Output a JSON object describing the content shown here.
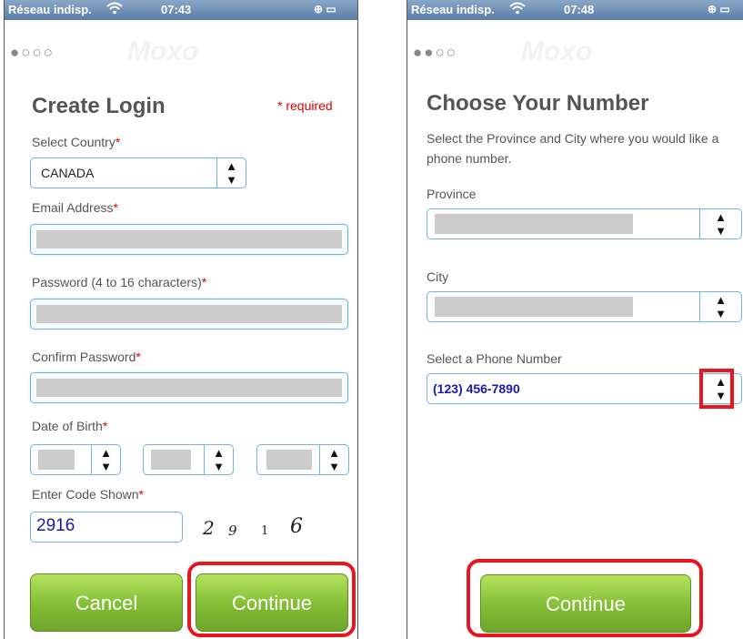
{
  "left": {
    "status": {
      "carrier": "Réseau indisp.",
      "time": "07:43",
      "icons": "⊕ ▭"
    },
    "progress_dots": "●○○○",
    "title": "Create Login",
    "required_note": "* required",
    "country": {
      "label": "Select Country",
      "value": "CANADA"
    },
    "email": {
      "label": "Email Address"
    },
    "password": {
      "label": "Password (4 to 16 characters)"
    },
    "confirm": {
      "label": "Confirm Password"
    },
    "dob": {
      "label": "Date of Birth"
    },
    "code": {
      "label": "Enter Code Shown",
      "value": "2916",
      "captcha": [
        "2",
        "9",
        "1",
        "6"
      ]
    },
    "buttons": {
      "cancel": "Cancel",
      "continue": "Continue"
    }
  },
  "right": {
    "status": {
      "carrier": "Réseau indisp.",
      "time": "07:48",
      "icons": "⊕ ▭"
    },
    "progress_dots": "●●○○",
    "title": "Choose Your Number",
    "description": "Select the Province and City where you would like a phone number.",
    "province": {
      "label": "Province"
    },
    "city": {
      "label": "City"
    },
    "phone": {
      "label": "Select a Phone Number",
      "value": "(123) 456-7890"
    },
    "buttons": {
      "continue": "Continue"
    }
  },
  "required_star": "*",
  "wifi_icon": "wifi-icon",
  "arrows_icon": "up-down-arrows-icon",
  "colors": {
    "accent_blue": "#6fb7d4",
    "button_green": "#82bd35",
    "highlight_red": "#e8141e",
    "required_red": "#e00000"
  }
}
